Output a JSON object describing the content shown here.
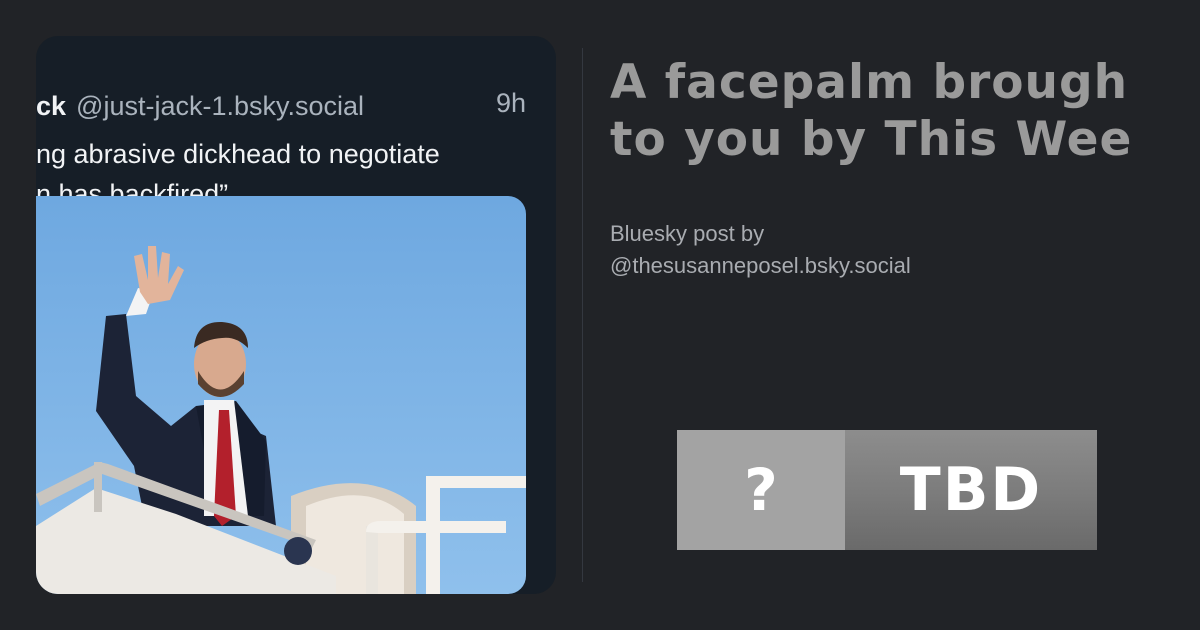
{
  "post": {
    "author_name": "ck",
    "author_handle": "@just-jack-1.bsky.social",
    "time": "9h",
    "text_line1": "ng abrasive dickhead to negotiate",
    "text_line2": "n has backfired”"
  },
  "headline": {
    "line1": "A facepalm brough",
    "line2": "to you by This Wee"
  },
  "byline": {
    "line1": "Bluesky post by",
    "line2": "@thesusanneposel.bsky.social"
  },
  "rating": {
    "icon": "?",
    "label": "TBD"
  },
  "colors": {
    "background": "#212327",
    "card": "#161e27",
    "headline": "#9a9a9a",
    "badge_icon": "#a3a3a3",
    "badge_label": "#7b7b7b"
  }
}
